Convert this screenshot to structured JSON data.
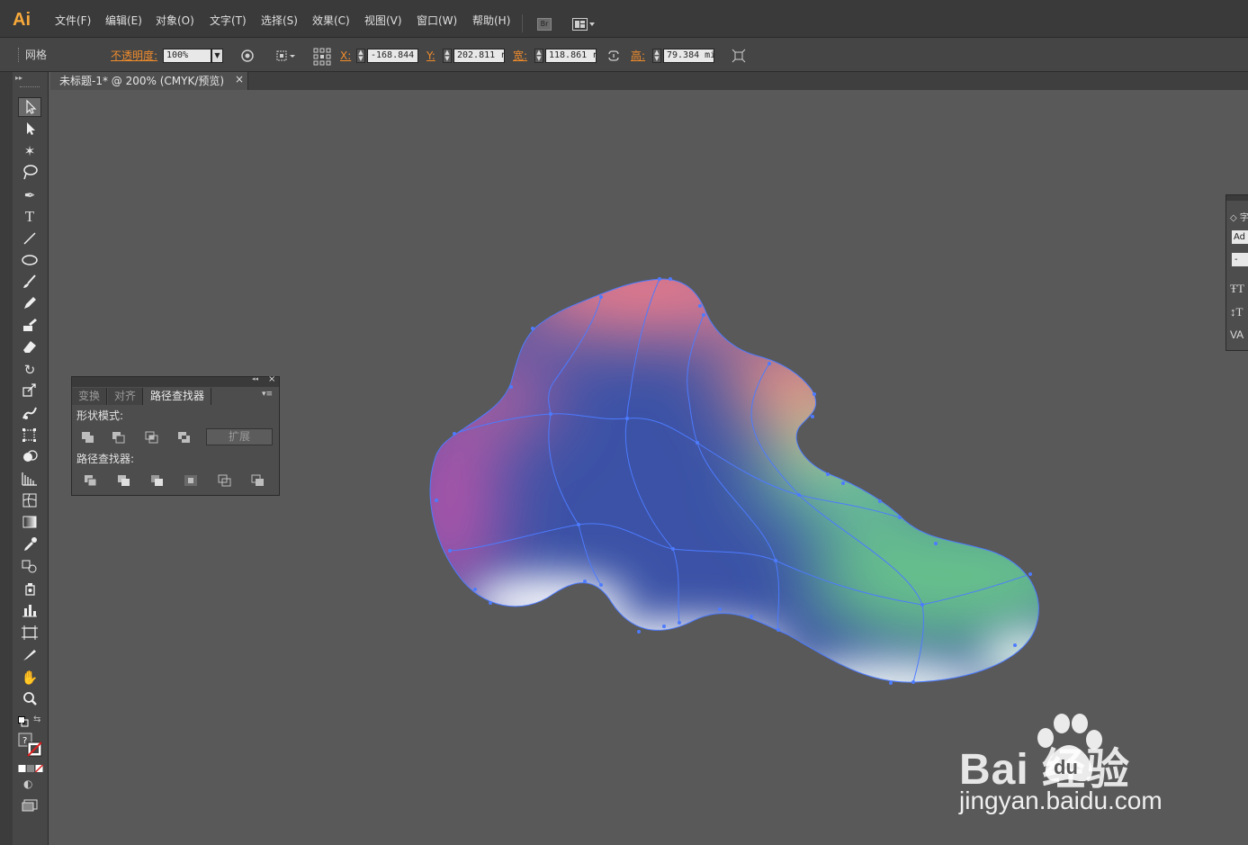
{
  "app": {
    "logo": "Ai",
    "menu": [
      "文件(F)",
      "编辑(E)",
      "对象(O)",
      "文字(T)",
      "选择(S)",
      "效果(C)",
      "视图(V)",
      "窗口(W)",
      "帮助(H)"
    ],
    "bridge_icon": "Br"
  },
  "control_bar": {
    "selection_type": "网格",
    "opacity_label": "不透明度:",
    "opacity_value": "100%",
    "x_label": "X:",
    "x_value": "-168.844",
    "y_label": "Y:",
    "y_value": "202.811 r",
    "w_label": "宽:",
    "w_value": "118.861 r",
    "h_label": "高:",
    "h_value": "79.384 mi"
  },
  "document_tab": {
    "title": "未标题-1* @ 200% (CMYK/预览)",
    "close": "×"
  },
  "pathfinder_panel": {
    "tabs": [
      "变换",
      "对齐",
      "路径查找器"
    ],
    "active_tab": "路径查找器",
    "shape_modes_label": "形状模式:",
    "expand_label": "扩展",
    "pathfinders_label": "路径查找器:",
    "collapse_glyph": "◂◂",
    "close_glyph": "×",
    "menu_glyph": "▾≡"
  },
  "char_panel": {
    "title_glyph": "◇ 字",
    "font_field": "Ad",
    "style_field": "-",
    "icons": [
      "font-size-icon",
      "leading-icon",
      "kerning-icon"
    ]
  },
  "watermark": {
    "brand": "Bai  经验",
    "url": "jingyan.baidu.com"
  },
  "colors": {
    "canvas": "#595959",
    "accent_orange": "#f08c2c",
    "mesh_line": "#4d7bff"
  }
}
